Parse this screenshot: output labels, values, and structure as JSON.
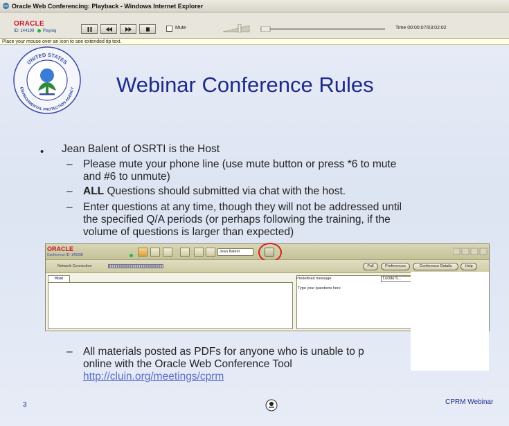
{
  "window": {
    "title": "Oracle Web Conferencing: Playback - Windows Internet Explorer"
  },
  "player": {
    "logo_text": "ORACLE",
    "id_text": "ID: 144199",
    "status": "Playing",
    "mute_label": "Mute",
    "time_label": "Time 00:00:07/03:02:02",
    "volume_level": 0.6,
    "seek_progress": 0.0
  },
  "tip": {
    "text": "Place your mouse over an icon to see extended tip text."
  },
  "slide": {
    "title": "Webinar Conference Rules",
    "bullet_main": "Jean Balent of OSRTI is the Host",
    "sub1_line1": "Please mute your phone line (use mute button or press *6 to mute",
    "sub1_line2": "and  #6 to unmute)",
    "sub2_bold": "ALL",
    "sub2_rest": " Questions should submitted via chat with the host.",
    "sub3_line1": "Enter questions at any time, though they will not be addressed until",
    "sub3_line2": "the specified Q/A periods (or perhaps following the training, if the",
    "sub3_line3": "volume of questions is larger than expected)",
    "sub4_line1": "All materials posted as PDFs for anyone who is unable to p",
    "sub4_line2": "online with the Oracle Web Conference Tool",
    "link": "http://cluin.org/meetings/cprm",
    "page_number": "3",
    "footer": "CPRM Webinar",
    "seal_text_top": "UNITED STATES",
    "seal_text_bottom": "ENVIRONMENTAL PROTECTION AGENCY"
  },
  "embedded_tool": {
    "logo": "ORACLE",
    "conference_id": "Conference ID: 145288",
    "host_select": "Jean Balent",
    "network_label": "Network Connection",
    "buttons": [
      "Poll",
      "Preferences",
      "Conference Details",
      "Help"
    ],
    "tab": "Host",
    "predefined_label": "Predefined message",
    "font_select": "Lucida S...",
    "chat_placeholder": "Type your questions here"
  },
  "colors": {
    "title_blue": "#1d2a8a",
    "oracle_red": "#c8102e",
    "link_blue": "#5a6ec8",
    "annotation_red": "#d02020"
  }
}
